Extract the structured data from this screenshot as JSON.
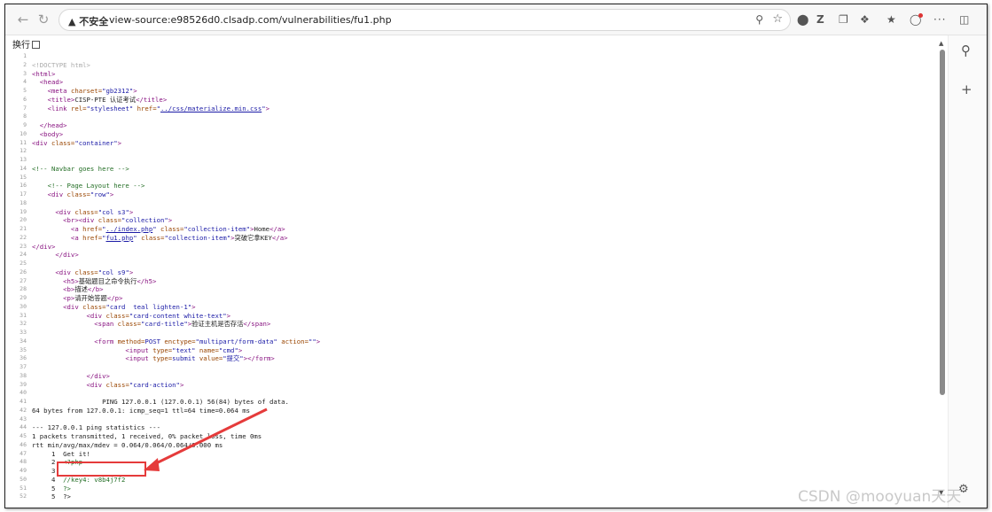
{
  "browser": {
    "security_label": "▲ 不安全",
    "url": "view-source:e98526d0.clsadp.com/vulnerabilities/fu1.php"
  },
  "wrap_label": "换行",
  "source_lines": [
    {
      "n": "1",
      "segs": []
    },
    {
      "n": "2",
      "segs": [
        {
          "c": "doc",
          "t": "<!DOCTYPE html>"
        }
      ]
    },
    {
      "n": "3",
      "segs": [
        {
          "c": "tag",
          "t": "<html>"
        }
      ]
    },
    {
      "n": "4",
      "segs": [
        {
          "c": "tag",
          "t": "  <head>"
        }
      ]
    },
    {
      "n": "5",
      "segs": [
        {
          "c": "tag",
          "t": "    <meta "
        },
        {
          "c": "attr",
          "t": "charset="
        },
        {
          "c": "val",
          "t": "\"gb2312\""
        },
        {
          "c": "tag",
          "t": ">"
        }
      ]
    },
    {
      "n": "6",
      "segs": [
        {
          "c": "tag",
          "t": "    <title>"
        },
        {
          "c": "plain",
          "t": "CISP-PTE 认证考试"
        },
        {
          "c": "tag",
          "t": "</title>"
        }
      ]
    },
    {
      "n": "7",
      "segs": [
        {
          "c": "tag",
          "t": "    <link "
        },
        {
          "c": "attr",
          "t": "rel="
        },
        {
          "c": "val",
          "t": "\"stylesheet\""
        },
        {
          "c": "attr",
          "t": " href="
        },
        {
          "c": "val",
          "t": "\""
        },
        {
          "c": "link",
          "t": "../css/materialize.min.css"
        },
        {
          "c": "val",
          "t": "\""
        },
        {
          "c": "tag",
          "t": ">"
        }
      ]
    },
    {
      "n": "8",
      "segs": []
    },
    {
      "n": "9",
      "segs": [
        {
          "c": "tag",
          "t": "  </head>"
        }
      ]
    },
    {
      "n": "10",
      "segs": [
        {
          "c": "tag",
          "t": "  <body>"
        }
      ]
    },
    {
      "n": "11",
      "segs": [
        {
          "c": "tag",
          "t": "<div "
        },
        {
          "c": "attr",
          "t": "class="
        },
        {
          "c": "val",
          "t": "\"container\""
        },
        {
          "c": "tag",
          "t": ">"
        }
      ]
    },
    {
      "n": "12",
      "segs": []
    },
    {
      "n": "13",
      "segs": []
    },
    {
      "n": "14",
      "segs": [
        {
          "c": "cmt",
          "t": "<!-- Navbar goes here -->"
        }
      ]
    },
    {
      "n": "15",
      "segs": []
    },
    {
      "n": "16",
      "segs": [
        {
          "c": "cmt",
          "t": "    <!-- Page Layout here -->"
        }
      ]
    },
    {
      "n": "17",
      "segs": [
        {
          "c": "tag",
          "t": "    <div "
        },
        {
          "c": "attr",
          "t": "class="
        },
        {
          "c": "val",
          "t": "\"row\""
        },
        {
          "c": "tag",
          "t": ">"
        }
      ]
    },
    {
      "n": "18",
      "segs": []
    },
    {
      "n": "19",
      "segs": [
        {
          "c": "tag",
          "t": "      <div "
        },
        {
          "c": "attr",
          "t": "class="
        },
        {
          "c": "val",
          "t": "\"col s3\""
        },
        {
          "c": "tag",
          "t": ">"
        }
      ]
    },
    {
      "n": "20",
      "segs": [
        {
          "c": "tag",
          "t": "        <br><div "
        },
        {
          "c": "attr",
          "t": "class="
        },
        {
          "c": "val",
          "t": "\"collection\""
        },
        {
          "c": "tag",
          "t": ">"
        }
      ]
    },
    {
      "n": "21",
      "segs": [
        {
          "c": "tag",
          "t": "          <a "
        },
        {
          "c": "attr",
          "t": "href="
        },
        {
          "c": "val",
          "t": "\""
        },
        {
          "c": "link",
          "t": "../index.php"
        },
        {
          "c": "val",
          "t": "\""
        },
        {
          "c": "attr",
          "t": " class="
        },
        {
          "c": "val",
          "t": "\"collection-item\""
        },
        {
          "c": "tag",
          "t": ">"
        },
        {
          "c": "plain",
          "t": "Home"
        },
        {
          "c": "tag",
          "t": "</a>"
        }
      ]
    },
    {
      "n": "22",
      "segs": [
        {
          "c": "tag",
          "t": "          <a "
        },
        {
          "c": "attr",
          "t": "href="
        },
        {
          "c": "val",
          "t": "\""
        },
        {
          "c": "link",
          "t": "fu1.php"
        },
        {
          "c": "val",
          "t": "\""
        },
        {
          "c": "attr",
          "t": " class="
        },
        {
          "c": "val",
          "t": "\"collection-item\""
        },
        {
          "c": "tag",
          "t": ">"
        },
        {
          "c": "plain",
          "t": "突破它拿KEY"
        },
        {
          "c": "tag",
          "t": "</a>"
        }
      ]
    },
    {
      "n": "23",
      "segs": [
        {
          "c": "tag",
          "t": "</div>"
        }
      ]
    },
    {
      "n": "24",
      "segs": [
        {
          "c": "tag",
          "t": "      </div>"
        }
      ]
    },
    {
      "n": "25",
      "segs": []
    },
    {
      "n": "26",
      "segs": [
        {
          "c": "tag",
          "t": "      <div "
        },
        {
          "c": "attr",
          "t": "class="
        },
        {
          "c": "val",
          "t": "\"col s9\""
        },
        {
          "c": "tag",
          "t": ">"
        }
      ]
    },
    {
      "n": "27",
      "segs": [
        {
          "c": "tag",
          "t": "        <h5>"
        },
        {
          "c": "plain",
          "t": "基础题目之命令执行"
        },
        {
          "c": "tag",
          "t": "</h5>"
        }
      ]
    },
    {
      "n": "28",
      "segs": [
        {
          "c": "tag",
          "t": "        <b>"
        },
        {
          "c": "plain",
          "t": "描述"
        },
        {
          "c": "tag",
          "t": "</b>"
        }
      ]
    },
    {
      "n": "29",
      "segs": [
        {
          "c": "tag",
          "t": "        <p>"
        },
        {
          "c": "plain",
          "t": "请开始答题"
        },
        {
          "c": "tag",
          "t": "</p>"
        }
      ]
    },
    {
      "n": "30",
      "segs": [
        {
          "c": "tag",
          "t": "        <div "
        },
        {
          "c": "attr",
          "t": "class="
        },
        {
          "c": "val",
          "t": "\"card  teal lighten-1\""
        },
        {
          "c": "tag",
          "t": ">"
        }
      ]
    },
    {
      "n": "31",
      "segs": [
        {
          "c": "tag",
          "t": "              <div "
        },
        {
          "c": "attr",
          "t": "class="
        },
        {
          "c": "val",
          "t": "\"card-content white-text\""
        },
        {
          "c": "tag",
          "t": ">"
        }
      ]
    },
    {
      "n": "32",
      "segs": [
        {
          "c": "tag",
          "t": "                <span "
        },
        {
          "c": "attr",
          "t": "class="
        },
        {
          "c": "val",
          "t": "\"card-title\""
        },
        {
          "c": "tag",
          "t": ">"
        },
        {
          "c": "plain",
          "t": "验证主机是否存活"
        },
        {
          "c": "tag",
          "t": "</span>"
        }
      ]
    },
    {
      "n": "33",
      "segs": []
    },
    {
      "n": "34",
      "segs": [
        {
          "c": "tag",
          "t": "                <form "
        },
        {
          "c": "attr",
          "t": "method="
        },
        {
          "c": "val",
          "t": "POST"
        },
        {
          "c": "attr",
          "t": " enctype="
        },
        {
          "c": "val",
          "t": "\"multipart/form-data\""
        },
        {
          "c": "attr",
          "t": " action="
        },
        {
          "c": "val",
          "t": "\"\""
        },
        {
          "c": "tag",
          "t": ">"
        }
      ]
    },
    {
      "n": "35",
      "segs": [
        {
          "c": "tag",
          "t": "                        <input "
        },
        {
          "c": "attr",
          "t": "type="
        },
        {
          "c": "val",
          "t": "\"text\""
        },
        {
          "c": "attr",
          "t": " name="
        },
        {
          "c": "val",
          "t": "\"cmd\""
        },
        {
          "c": "tag",
          "t": ">"
        }
      ]
    },
    {
      "n": "36",
      "segs": [
        {
          "c": "tag",
          "t": "                        <input "
        },
        {
          "c": "attr",
          "t": "type="
        },
        {
          "c": "val",
          "t": "submit"
        },
        {
          "c": "attr",
          "t": " value="
        },
        {
          "c": "val",
          "t": "\"提交\""
        },
        {
          "c": "tag",
          "t": "></form>"
        }
      ]
    },
    {
      "n": "37",
      "segs": []
    },
    {
      "n": "38",
      "segs": [
        {
          "c": "tag",
          "t": "              </div>"
        }
      ]
    },
    {
      "n": "39",
      "segs": [
        {
          "c": "tag",
          "t": "              <div "
        },
        {
          "c": "attr",
          "t": "class="
        },
        {
          "c": "val",
          "t": "\"card-action\""
        },
        {
          "c": "tag",
          "t": ">"
        }
      ]
    },
    {
      "n": "40",
      "segs": []
    },
    {
      "n": "41",
      "segs": [
        {
          "c": "plain",
          "t": "                  PING 127.0.0.1 (127.0.0.1) 56(84) bytes of data."
        }
      ]
    },
    {
      "n": "42",
      "segs": [
        {
          "c": "plain",
          "t": "64 bytes from 127.0.0.1: icmp_seq=1 ttl=64 time=0.064 ms"
        }
      ]
    },
    {
      "n": "43",
      "segs": []
    },
    {
      "n": "44",
      "segs": [
        {
          "c": "plain",
          "t": "--- 127.0.0.1 ping statistics ---"
        }
      ]
    },
    {
      "n": "45",
      "segs": [
        {
          "c": "plain",
          "t": "1 packets transmitted, 1 received, 0% packet loss, time 0ms"
        }
      ]
    },
    {
      "n": "46",
      "segs": [
        {
          "c": "plain",
          "t": "rtt min/avg/max/mdev = 0.064/0.064/0.064/0.000 ms"
        }
      ]
    },
    {
      "n": "47",
      "segs": [
        {
          "c": "plain",
          "t": "     1  Get it!"
        }
      ]
    },
    {
      "n": "48",
      "segs": [
        {
          "c": "plain",
          "t": "     2  "
        },
        {
          "c": "grn",
          "t": "<?php"
        }
      ]
    },
    {
      "n": "49",
      "segs": [
        {
          "c": "plain",
          "t": "     3"
        }
      ]
    },
    {
      "n": "50",
      "segs": [
        {
          "c": "plain",
          "t": "     4  "
        },
        {
          "c": "grn",
          "t": "//key4: v8b4j7f2"
        }
      ]
    },
    {
      "n": "51",
      "segs": [
        {
          "c": "plain",
          "t": "     5  "
        },
        {
          "c": "grn",
          "t": "?>"
        }
      ]
    },
    {
      "n": "52",
      "segs": [
        {
          "c": "plain",
          "t": "     5  ?>"
        }
      ]
    }
  ],
  "watermark": "CSDN @mooyuan天天"
}
